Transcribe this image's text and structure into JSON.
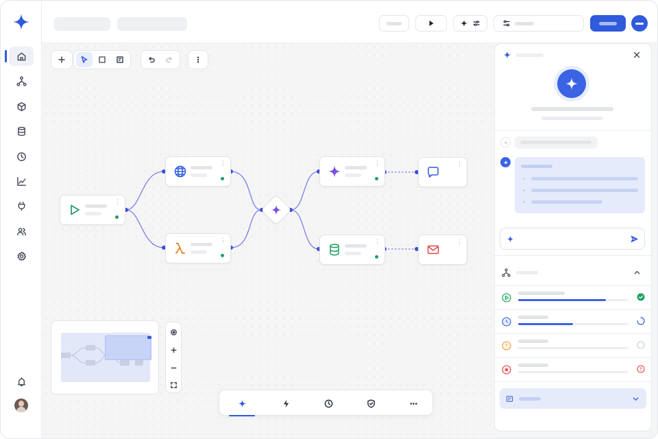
{
  "app": {
    "brand_color": "#2f5bdc",
    "accent_color": "#3b64e4"
  },
  "sidebar": {
    "items": [
      {
        "name": "home",
        "icon": "home-icon",
        "active": true
      },
      {
        "name": "workflows",
        "icon": "workflow-icon",
        "active": false
      },
      {
        "name": "packages",
        "icon": "cube-icon",
        "active": false
      },
      {
        "name": "data",
        "icon": "database-icon",
        "active": false
      },
      {
        "name": "history",
        "icon": "clock-icon",
        "active": false
      },
      {
        "name": "analytics",
        "icon": "chart-icon",
        "active": false
      },
      {
        "name": "integrations",
        "icon": "plug-icon",
        "active": false
      },
      {
        "name": "team",
        "icon": "users-icon",
        "active": false
      },
      {
        "name": "settings",
        "icon": "gear-icon",
        "active": false
      }
    ],
    "bottom": [
      "bell-icon",
      "avatar"
    ]
  },
  "canvas": {
    "nodes": [
      {
        "id": "trigger",
        "icon": "play-icon",
        "color": "#1e9e62"
      },
      {
        "id": "http",
        "icon": "globe-icon",
        "color": "#2f5bdc"
      },
      {
        "id": "lambda",
        "icon": "lambda-icon",
        "color": "#e7862a"
      },
      {
        "id": "ai-merge",
        "icon": "sparkle-icon",
        "color": "#7b4fe0"
      },
      {
        "id": "ai-step",
        "icon": "sparkle-icon",
        "color": "#7b4fe0"
      },
      {
        "id": "database",
        "icon": "database-icon",
        "color": "#1e9e62"
      },
      {
        "id": "message",
        "icon": "chat-icon",
        "color": "#2f5bdc"
      },
      {
        "id": "email",
        "icon": "mail-icon",
        "color": "#e04646"
      }
    ],
    "edge_color": "#7c7fe4",
    "dock_active": "sparkle"
  },
  "panel": {
    "tasks": [
      {
        "status": "success",
        "progress": 0.8,
        "color": "#1e9e62"
      },
      {
        "status": "running",
        "progress": 0.5,
        "color": "#2f5bdc"
      },
      {
        "status": "pending",
        "progress": 0,
        "color": "#e7a23b"
      },
      {
        "status": "error",
        "progress": 0,
        "color": "#e04646"
      }
    ]
  }
}
